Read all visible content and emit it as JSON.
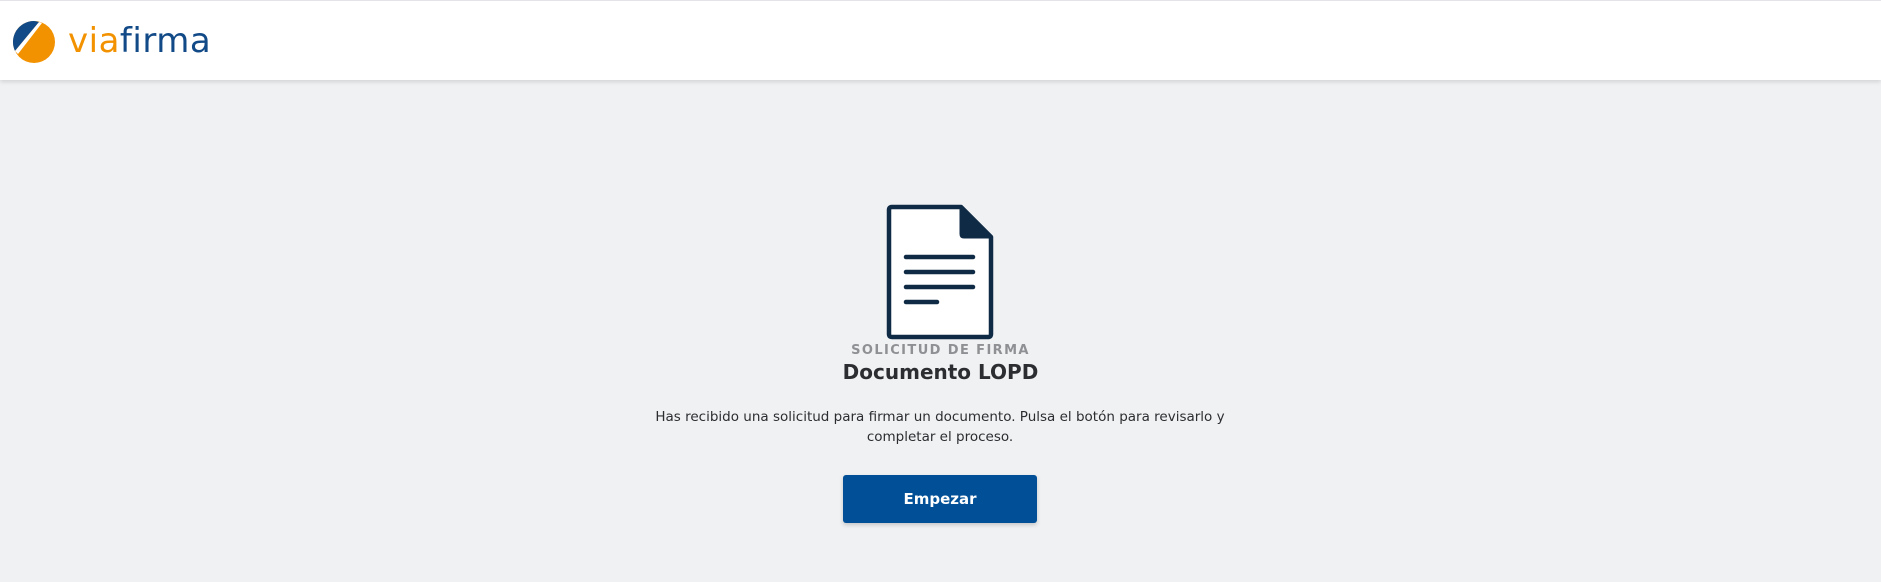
{
  "header": {
    "logo": {
      "icon": "viafirma-logo-icon",
      "text_part1": "via",
      "text_part2": "firma",
      "colors": {
        "orange": "#f39200",
        "blue": "#124a88"
      }
    }
  },
  "main": {
    "icon": "document-icon",
    "subtitle": "SOLICITUD DE FIRMA",
    "title": "Documento LOPD",
    "message": "Has recibido una solicitud para firmar un documento. Pulsa el botón para revisarlo y completar el proceso.",
    "button_label": "Empezar",
    "colors": {
      "button": "#014f96",
      "icon_stroke": "#0f2a44",
      "background": "#f0f1f3"
    }
  }
}
